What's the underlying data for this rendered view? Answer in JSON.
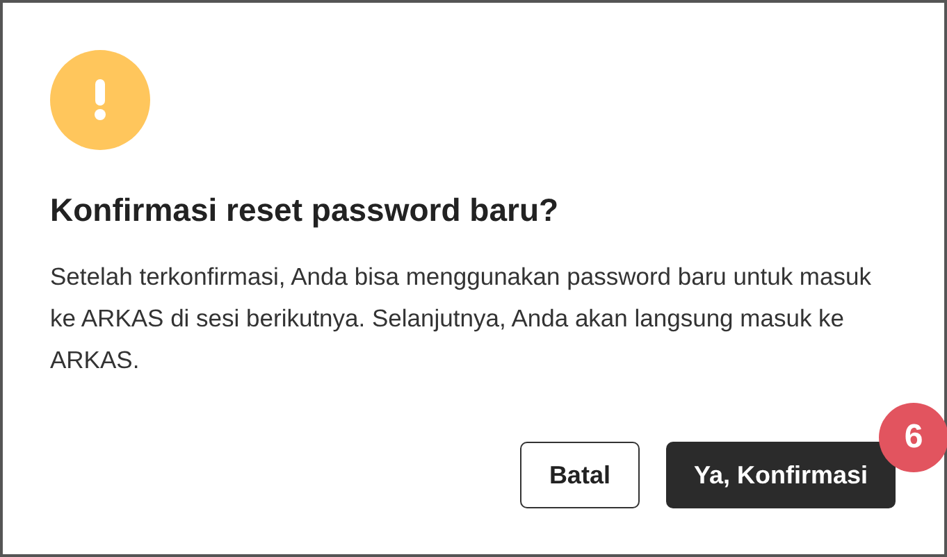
{
  "dialog": {
    "title": "Konfirmasi reset password baru?",
    "message": "Setelah terkonfirmasi, Anda bisa menggunakan password baru untuk masuk ke ARKAS di sesi berikutnya. Selanjutnya, Anda akan langsung masuk ke ARKAS.",
    "buttons": [
      {
        "label": "Batal",
        "kind": "secondary"
      },
      {
        "label": "Ya, Konfirmasi",
        "kind": "primary"
      }
    ],
    "step_badge": "6"
  }
}
